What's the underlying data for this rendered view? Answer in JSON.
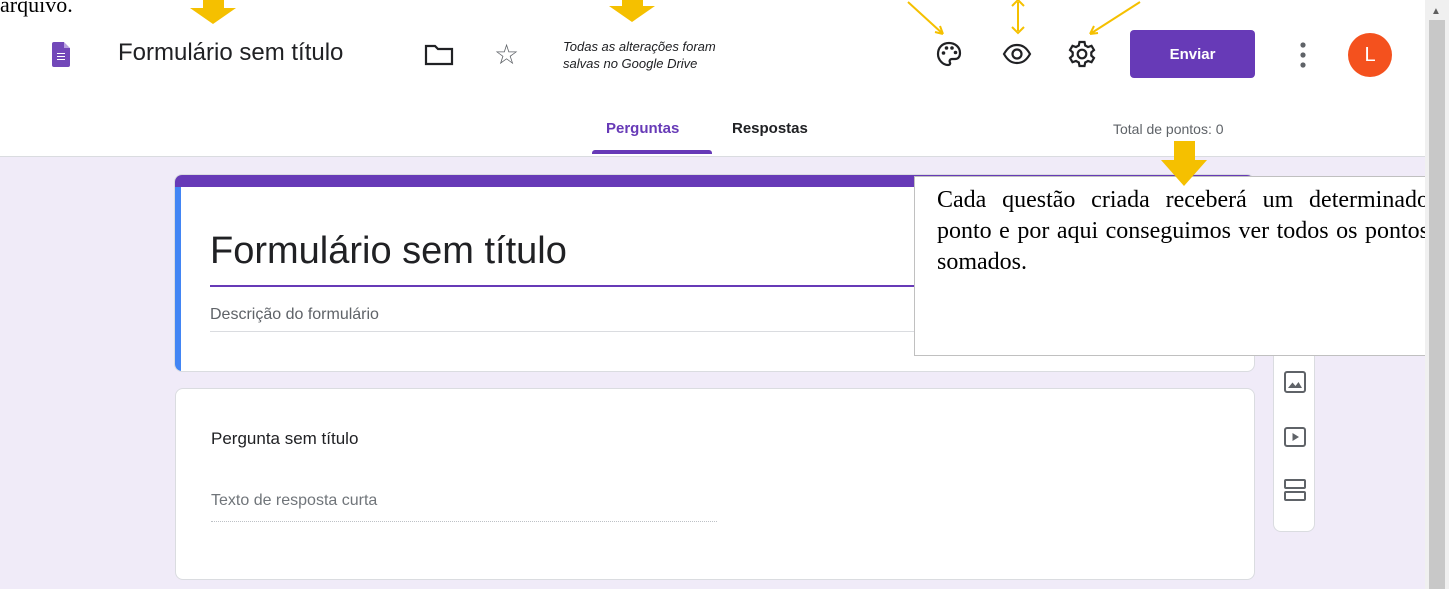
{
  "caption": "arquivo.",
  "header": {
    "form_title": "Formulário sem título",
    "saved_line1": "Todas as alterações foram",
    "saved_line2": "salvas no Google Drive",
    "send_label": "Enviar",
    "avatar_letter": "L",
    "icons": [
      "forms-logo-icon",
      "folder-icon",
      "star-icon",
      "palette-icon",
      "eye-icon",
      "gear-icon",
      "more-vert-icon"
    ]
  },
  "tabs": {
    "questions": "Perguntas",
    "responses": "Respostas",
    "total_points": "Total de pontos: 0"
  },
  "title_card": {
    "title": "Formulário sem título",
    "description": "Descrição do formulário"
  },
  "question_card": {
    "title": "Pergunta sem título",
    "answer_placeholder": "Texto de resposta curta"
  },
  "sidebar": {
    "icons": [
      "image-icon",
      "video-icon",
      "section-icon"
    ]
  },
  "callout": {
    "text": "Cada questão criada receberá um determinado ponto e por aqui conseguimos ver todos os pontos somados."
  },
  "colors": {
    "accent": "#673ab7",
    "annotation": "#f5c000",
    "avatar": "#f4511e",
    "canvas": "#f0ebf8"
  }
}
